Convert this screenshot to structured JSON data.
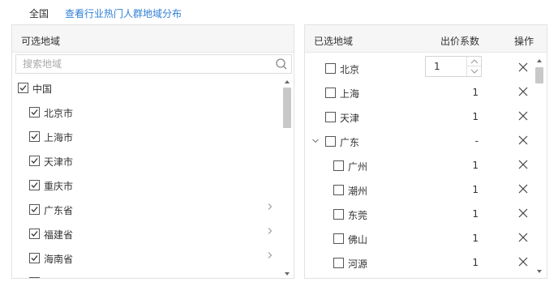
{
  "topbar": {
    "scope_label": "全国",
    "link_label": "查看行业热门人群地域分布"
  },
  "left_panel": {
    "title": "可选地域",
    "search_placeholder": "搜索地域",
    "root": {
      "label": "中国",
      "checked": true
    },
    "items": [
      {
        "label": "北京市",
        "checked": true,
        "has_children": false
      },
      {
        "label": "上海市",
        "checked": true,
        "has_children": false
      },
      {
        "label": "天津市",
        "checked": true,
        "has_children": false
      },
      {
        "label": "重庆市",
        "checked": true,
        "has_children": false
      },
      {
        "label": "广东省",
        "checked": true,
        "has_children": true
      },
      {
        "label": "福建省",
        "checked": true,
        "has_children": true
      },
      {
        "label": "海南省",
        "checked": true,
        "has_children": true
      }
    ]
  },
  "right_panel": {
    "title": "已选地域",
    "col_bid": "出价系数",
    "col_action": "操作",
    "rows": [
      {
        "label": "北京",
        "bid": "1",
        "editing": true,
        "level": 0
      },
      {
        "label": "上海",
        "bid": "1",
        "level": 0
      },
      {
        "label": "天津",
        "bid": "1",
        "level": 0
      },
      {
        "label": "广东",
        "bid": "-",
        "level": 0,
        "expanded": true
      },
      {
        "label": "广州",
        "bid": "1",
        "level": 1
      },
      {
        "label": "潮州",
        "bid": "1",
        "level": 1
      },
      {
        "label": "东莞",
        "bid": "1",
        "level": 1
      },
      {
        "label": "佛山",
        "bid": "1",
        "level": 1
      },
      {
        "label": "河源",
        "bid": "1",
        "level": 1
      }
    ]
  },
  "icons": {
    "search": "search-icon",
    "check": "check-icon",
    "close": "close-icon",
    "chevron_right": "chevron-right-icon",
    "chevron_down": "chevron-down-icon"
  },
  "colors": {
    "link": "#2f7fd6",
    "header_bg": "#f6f6f6",
    "border": "#e3e3e3"
  }
}
